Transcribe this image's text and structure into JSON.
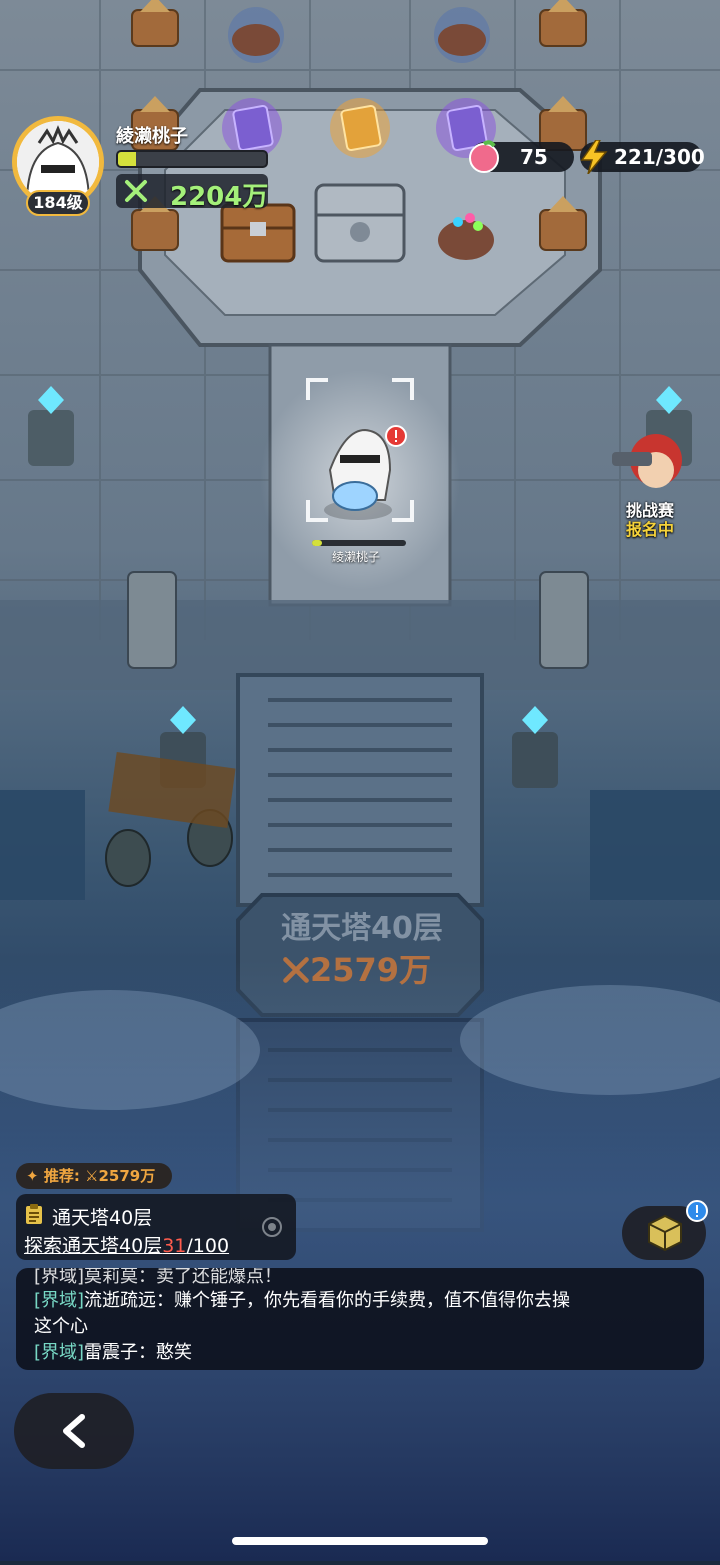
{
  "player": {
    "name": "綾濑桃子",
    "level": "184级",
    "exp_fraction": 0.12,
    "power": "2204万"
  },
  "resources": {
    "peach": "75",
    "stamina": "221/300"
  },
  "event": {
    "line1": "挑战赛",
    "line2": "报名中"
  },
  "character": {
    "name": "綾濑桃子"
  },
  "floor_plate": {
    "title": "通天塔40层",
    "power": "2579万"
  },
  "recommend": {
    "label": "推荐:",
    "power": "2579万"
  },
  "quest": {
    "title": "通天塔40层",
    "desc": "探索通天塔40层",
    "progress": "31",
    "total": "/100"
  },
  "chat": {
    "partial": "[界域]莫莉莫：卖了还能爆点！",
    "line1_tag": "[界域]",
    "line1_text": "流逝疏远：赚个锤子，你先看看你的手续费，值不值得你去操",
    "line1_cont": "这个心",
    "line2_tag": "[界域]",
    "line2_text": "雷震子：憨笑"
  },
  "colors": {
    "gold": "#f1b93e",
    "power_green": "#a4f07a",
    "chat_tag": "#78d8c5",
    "progress_red": "#ff5c4d",
    "event_yellow": "#f5d23a"
  }
}
